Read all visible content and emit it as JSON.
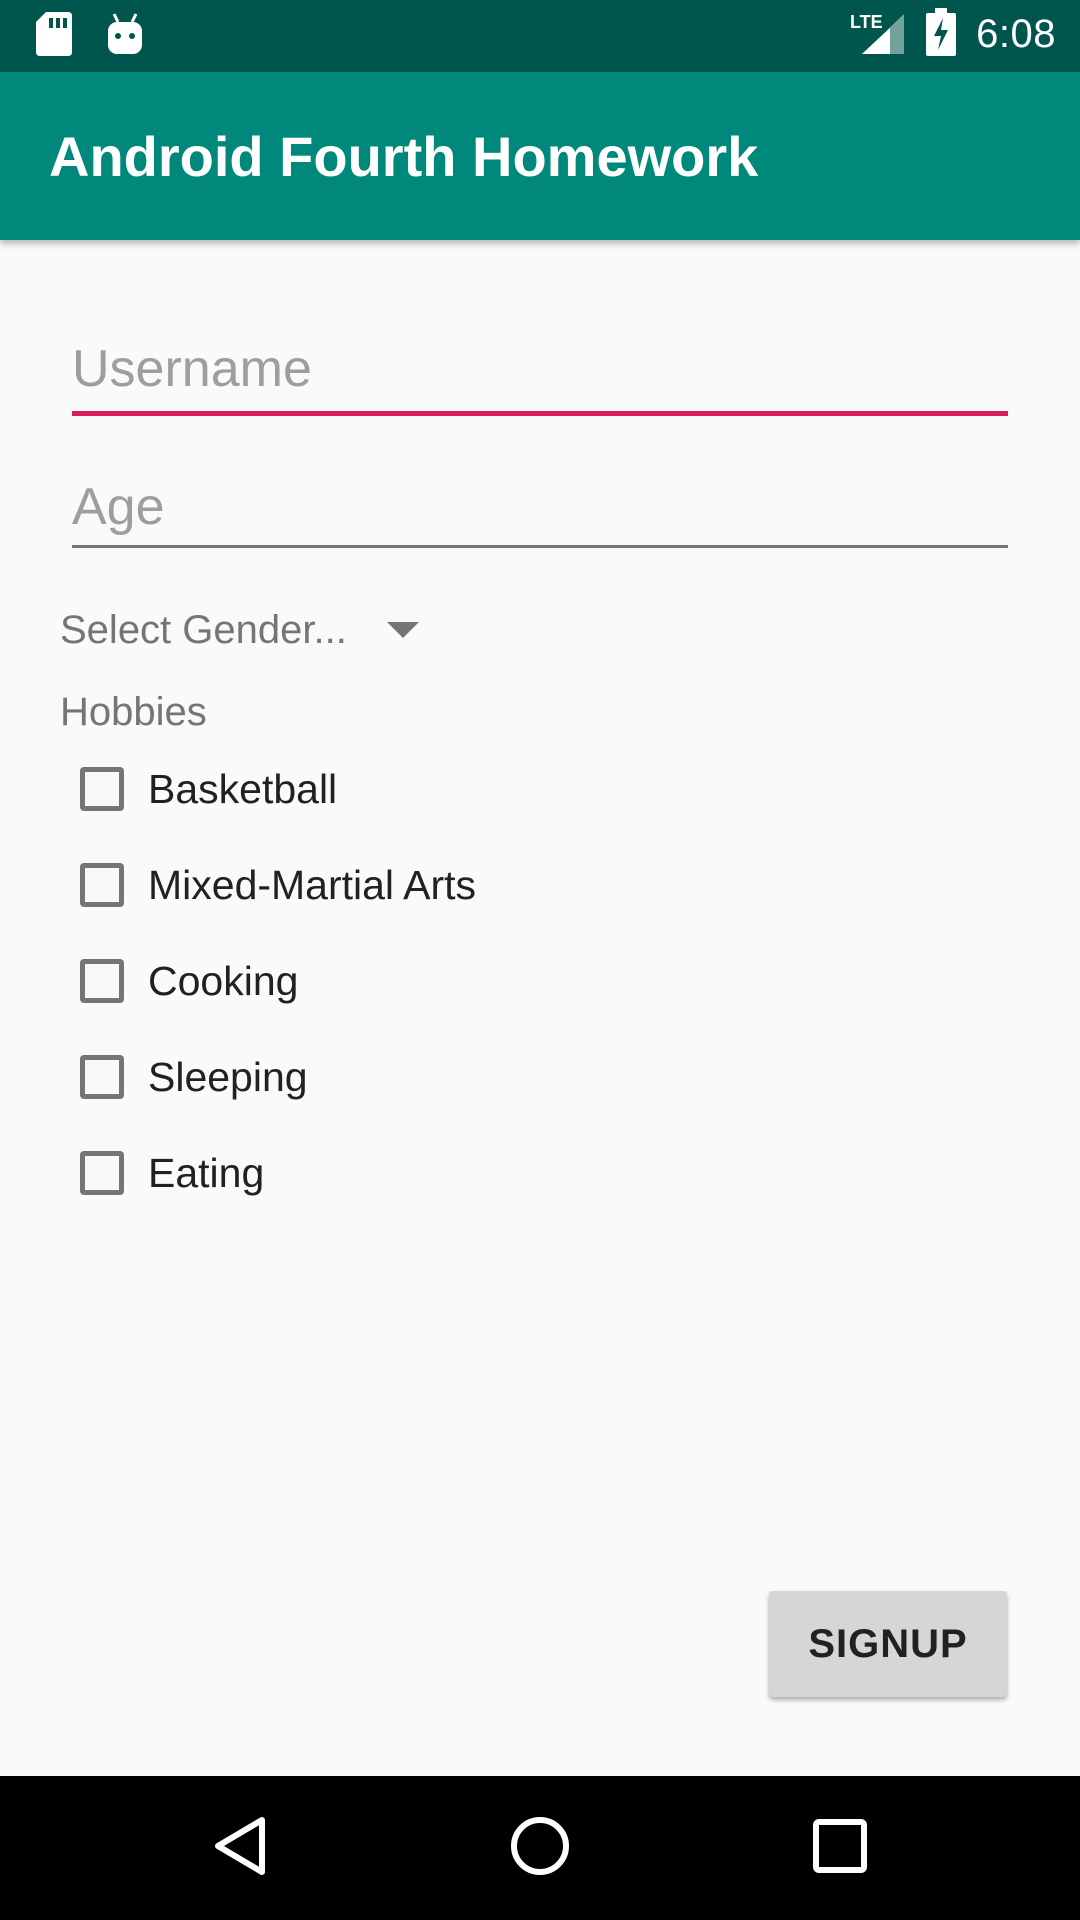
{
  "status_bar": {
    "time": "6:08",
    "icons": [
      "sd-card-icon",
      "android-icon",
      "lte-signal-icon",
      "battery-charging-icon"
    ]
  },
  "app_bar": {
    "title": "Android Fourth Homework"
  },
  "form": {
    "username": {
      "placeholder": "Username",
      "value": ""
    },
    "age": {
      "placeholder": "Age",
      "value": ""
    },
    "gender": {
      "selected": "Select Gender..."
    },
    "hobbies_label": "Hobbies",
    "hobbies": [
      {
        "label": "Basketball",
        "checked": false
      },
      {
        "label": "Mixed-Martial Arts",
        "checked": false
      },
      {
        "label": "Cooking",
        "checked": false
      },
      {
        "label": "Sleeping",
        "checked": false
      },
      {
        "label": "Eating",
        "checked": false
      }
    ],
    "signup_label": "SIGNUP"
  },
  "colors": {
    "status_bar": "#00564d",
    "app_bar": "#00897b",
    "accent": "#d81b60"
  },
  "nav_bar": {
    "icons": [
      "back-icon",
      "home-icon",
      "recents-icon"
    ]
  }
}
